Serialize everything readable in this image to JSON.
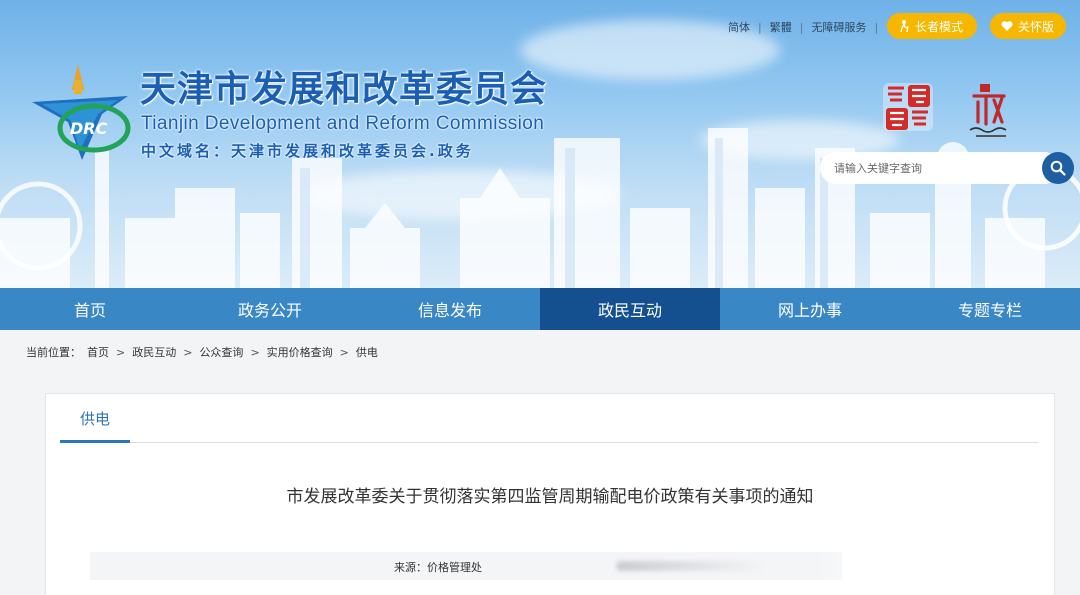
{
  "top_links": [
    "简体",
    "繁體",
    "无障碍服务"
  ],
  "elder_mode_label": "长者模式",
  "care_mode_label": "关怀版",
  "site": {
    "title_zh": "天津市发展和改革委员会",
    "title_en": "Tianjin Development and Reform Commission",
    "domain_label": "中文域名：天津市发展和改革委员会.政务",
    "logo_text": "DRC"
  },
  "search": {
    "placeholder": "请输入关键字查询"
  },
  "nav": [
    "首页",
    "政务公开",
    "信息发布",
    "政民互动",
    "网上办事",
    "专题专栏"
  ],
  "nav_active_index": 3,
  "breadcrumb": {
    "label": "当前位置：",
    "items": [
      "首页",
      "政民互动",
      "公众查询",
      "实用价格查询",
      "供电"
    ],
    "separator": ">"
  },
  "content": {
    "tab_label": "供电",
    "article_title": "市发展改革委关于贯彻落实第四监管周期输配电价政策有关事项的通知",
    "source_label": "来源：价格管理处"
  },
  "colors": {
    "nav_bg": "#3a87c6",
    "nav_active_bg": "#14508f",
    "brand_blue": "#1a5fb4",
    "pill_yellow": "#f5b700",
    "tab_blue": "#2f75b5"
  }
}
